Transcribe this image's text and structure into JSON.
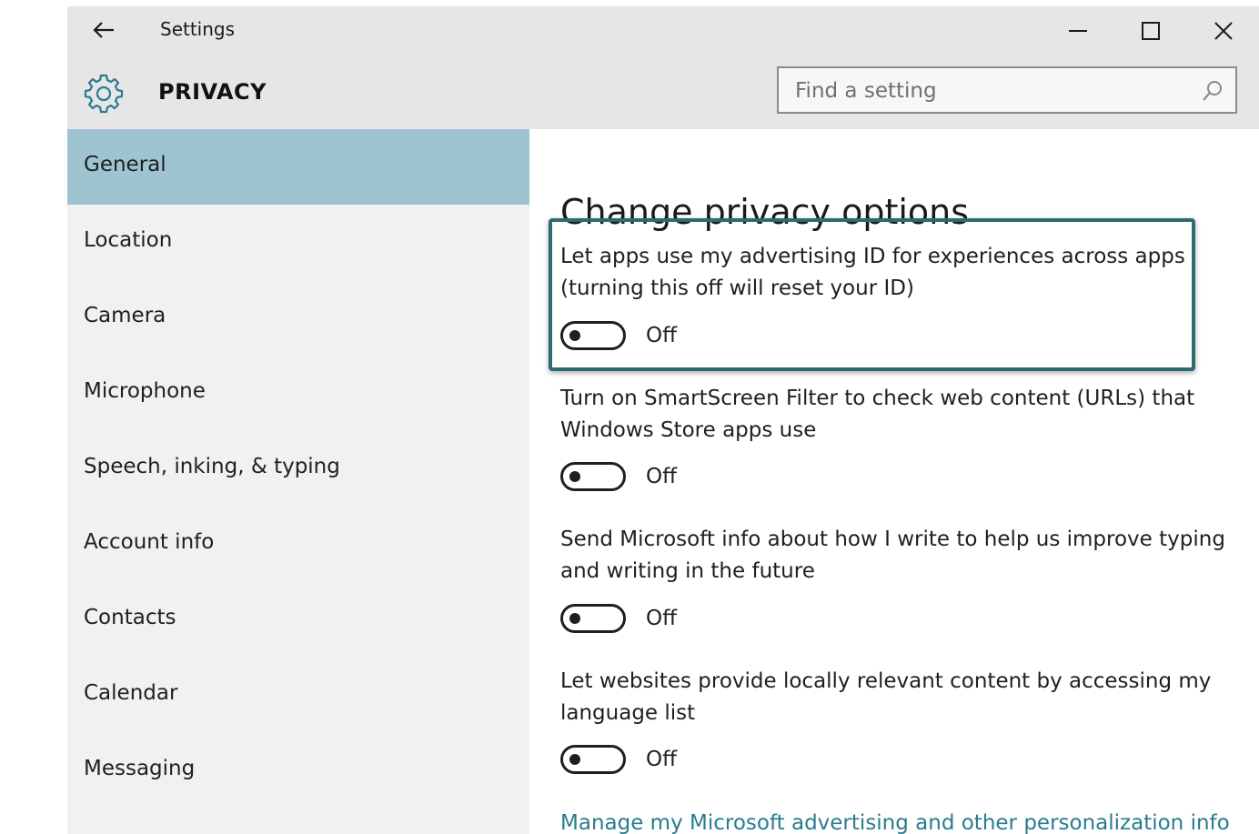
{
  "window": {
    "title": "Settings",
    "header_title": "PRIVACY",
    "icons": {
      "back": "back-arrow-icon",
      "header": "gear-icon",
      "minimize": "minimize-icon",
      "maximize": "maximize-icon",
      "close": "close-icon",
      "search": "search-icon"
    }
  },
  "search": {
    "placeholder": "Find a setting",
    "value": ""
  },
  "sidebar": {
    "selected_index": 0,
    "items": [
      {
        "label": "General"
      },
      {
        "label": "Location"
      },
      {
        "label": "Camera"
      },
      {
        "label": "Microphone"
      },
      {
        "label": "Speech, inking, & typing"
      },
      {
        "label": "Account info"
      },
      {
        "label": "Contacts"
      },
      {
        "label": "Calendar"
      },
      {
        "label": "Messaging"
      }
    ]
  },
  "main": {
    "title": "Change privacy options",
    "settings": [
      {
        "description": "Let apps use my advertising ID for experiences across apps (turning this off will reset your ID)",
        "state": "Off",
        "highlighted": true
      },
      {
        "description": "Turn on SmartScreen Filter to check web content (URLs) that Windows Store apps use",
        "state": "Off",
        "highlighted": false
      },
      {
        "description": "Send Microsoft info about how I write to help us improve typing and writing in the future",
        "state": "Off",
        "highlighted": false
      },
      {
        "description": "Let websites provide locally relevant content by accessing my language list",
        "state": "Off",
        "highlighted": false
      }
    ],
    "link_text": "Manage my Microsoft advertising and other personalization info"
  },
  "colors": {
    "selected_nav": "#9fc4d1",
    "highlight_border": "#2e6a73",
    "link": "#2a7b8f",
    "titlebar": "#e6e6e6",
    "sidebar": "#f1f1f1"
  }
}
